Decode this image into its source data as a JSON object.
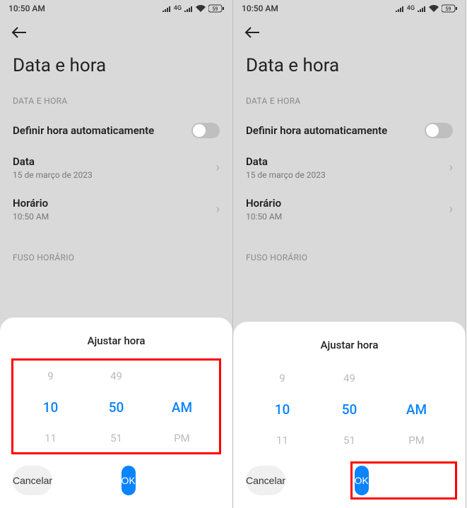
{
  "status": {
    "time": "10:50 AM",
    "network_label": "4G",
    "battery_label": "59"
  },
  "page": {
    "title": "Data e hora",
    "section_date_time": "DATA E HORA",
    "auto_time_label": "Definir hora automaticamente",
    "date_label": "Data",
    "date_value": "15 de março de 2023",
    "time_label": "Horário",
    "time_value": "10:50 AM",
    "section_timezone": "FUSO HORÁRIO"
  },
  "sheet": {
    "title": "Ajustar hora",
    "hour_prev": "9",
    "hour_sel": "10",
    "hour_next": "11",
    "minute_prev": "49",
    "minute_sel": "50",
    "minute_next": "51",
    "ampm_prev": "",
    "ampm_sel": "AM",
    "ampm_next": "PM",
    "cancel": "Cancelar",
    "ok": "OK"
  }
}
